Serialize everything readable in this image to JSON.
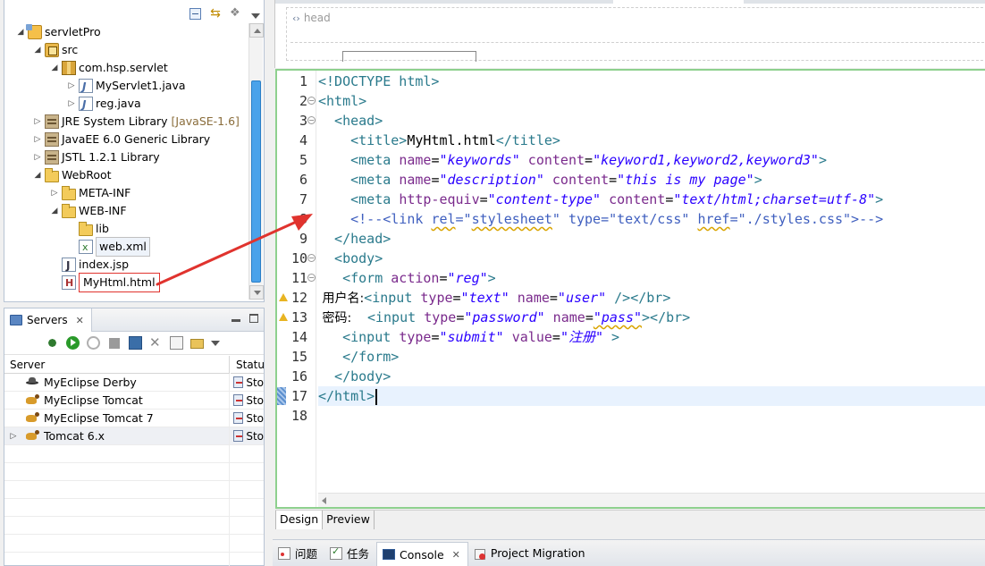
{
  "explorer": {
    "tree": [
      {
        "label": "servletPro",
        "twisty": "◢",
        "icon": "project-icon",
        "indent": 0
      },
      {
        "label": "src",
        "twisty": "◢",
        "icon": "source-folder-icon",
        "indent": 1
      },
      {
        "label": "com.hsp.servlet",
        "twisty": "◢",
        "icon": "package-icon",
        "indent": 2
      },
      {
        "label": "MyServlet1.java",
        "twisty": "▷",
        "icon": "java-file-icon",
        "indent": 3
      },
      {
        "label": "reg.java",
        "twisty": "▷",
        "icon": "java-file-icon",
        "indent": 3
      },
      {
        "label": "JRE System Library",
        "version": "[JavaSE-1.6]",
        "twisty": "▷",
        "icon": "library-icon",
        "indent": 1
      },
      {
        "label": "JavaEE 6.0 Generic Library",
        "twisty": "▷",
        "icon": "library-icon",
        "indent": 1
      },
      {
        "label": "JSTL 1.2.1 Library",
        "twisty": "▷",
        "icon": "library-icon",
        "indent": 1
      },
      {
        "label": "WebRoot",
        "twisty": "◢",
        "icon": "folder-icon",
        "indent": 1
      },
      {
        "label": "META-INF",
        "twisty": "▷",
        "icon": "folder-icon",
        "indent": 2
      },
      {
        "label": "WEB-INF",
        "twisty": "◢",
        "icon": "folder-icon",
        "indent": 2
      },
      {
        "label": "lib",
        "twisty": "",
        "icon": "folder-icon",
        "indent": 3
      },
      {
        "label": "web.xml",
        "twisty": "",
        "icon": "xml-file-icon",
        "indent": 3,
        "selected": true
      },
      {
        "label": "index.jsp",
        "twisty": "",
        "icon": "jsp-file-icon",
        "indent": 2
      },
      {
        "label": "MyHtml.html",
        "twisty": "",
        "icon": "html-file-icon",
        "indent": 2,
        "highlighted": true
      }
    ]
  },
  "servers": {
    "tab_label": "Servers",
    "columns": {
      "server": "Server",
      "status": "Status"
    },
    "rows": [
      {
        "name": "MyEclipse Derby",
        "status": "Sto",
        "icon": "derby-icon",
        "twisty": ""
      },
      {
        "name": "MyEclipse Tomcat",
        "status": "Sto",
        "icon": "tomcat-icon",
        "twisty": ""
      },
      {
        "name": "MyEclipse Tomcat 7",
        "status": "Sto",
        "icon": "tomcat-icon",
        "twisty": ""
      },
      {
        "name": "Tomcat  6.x",
        "status": "Sto",
        "icon": "tomcat-icon",
        "twisty": "▷",
        "selected": true
      }
    ]
  },
  "design_view": {
    "head_label": "head"
  },
  "editor": {
    "current_line": 17,
    "lines": [
      {
        "n": "1",
        "tokens": [
          {
            "t": "<!DOCTYPE html>",
            "c": "tag"
          }
        ]
      },
      {
        "n": "2",
        "fold": true,
        "tokens": [
          {
            "t": "<html>",
            "c": "tag"
          }
        ]
      },
      {
        "n": "3",
        "fold": true,
        "tokens": [
          {
            "t": "  <head>",
            "c": "tag"
          }
        ]
      },
      {
        "n": "4",
        "tokens": [
          {
            "t": "    <title>",
            "c": "tag"
          },
          {
            "t": "MyHtml.html",
            "c": "text"
          },
          {
            "t": "</title>",
            "c": "tag"
          }
        ]
      },
      {
        "n": "5",
        "tokens": [
          {
            "t": "    <meta ",
            "c": "tag"
          },
          {
            "t": "name",
            "c": "attr"
          },
          {
            "t": "=",
            "c": "text"
          },
          {
            "t": "\"keywords\"",
            "c": "val"
          },
          {
            "t": " content",
            "c": "attr"
          },
          {
            "t": "=",
            "c": "text"
          },
          {
            "t": "\"keyword1,keyword2,keyword3\"",
            "c": "val"
          },
          {
            "t": ">",
            "c": "tag"
          }
        ]
      },
      {
        "n": "6",
        "tokens": [
          {
            "t": "    <meta ",
            "c": "tag"
          },
          {
            "t": "name",
            "c": "attr"
          },
          {
            "t": "=",
            "c": "text"
          },
          {
            "t": "\"description\"",
            "c": "val"
          },
          {
            "t": " content",
            "c": "attr"
          },
          {
            "t": "=",
            "c": "text"
          },
          {
            "t": "\"this is my page\"",
            "c": "val"
          },
          {
            "t": ">",
            "c": "tag"
          }
        ]
      },
      {
        "n": "7",
        "tokens": [
          {
            "t": "    <meta ",
            "c": "tag"
          },
          {
            "t": "http-equiv",
            "c": "attr"
          },
          {
            "t": "=",
            "c": "text"
          },
          {
            "t": "\"content-type\"",
            "c": "val"
          },
          {
            "t": " content",
            "c": "attr"
          },
          {
            "t": "=",
            "c": "text"
          },
          {
            "t": "\"text/html;charset=utf-8\"",
            "c": "val"
          },
          {
            "t": ">",
            "c": "tag"
          }
        ]
      },
      {
        "n": "8",
        "tokens": [
          {
            "t": "    <!--<link ",
            "c": "comment"
          },
          {
            "t": "rel",
            "c": "comment",
            "w": true
          },
          {
            "t": "=\"",
            "c": "comment"
          },
          {
            "t": "stylesheet",
            "c": "comment",
            "w": true
          },
          {
            "t": "\" type=\"text/css\" ",
            "c": "comment"
          },
          {
            "t": "href",
            "c": "comment",
            "w": true
          },
          {
            "t": "=\"./styles.css\">-->",
            "c": "comment"
          }
        ]
      },
      {
        "n": "9",
        "tokens": [
          {
            "t": "  </head>",
            "c": "tag"
          }
        ]
      },
      {
        "n": "10",
        "fold": true,
        "tokens": [
          {
            "t": "  <body>",
            "c": "tag"
          }
        ]
      },
      {
        "n": "11",
        "fold": true,
        "tokens": [
          {
            "t": "   <form ",
            "c": "tag"
          },
          {
            "t": "action",
            "c": "attr"
          },
          {
            "t": "=",
            "c": "text"
          },
          {
            "t": "\"reg\"",
            "c": "val"
          },
          {
            "t": ">",
            "c": "tag"
          }
        ]
      },
      {
        "n": "12",
        "warn": true,
        "tokens": [
          {
            "t": " 用户名:",
            "c": "cjk"
          },
          {
            "t": "<input ",
            "c": "tag"
          },
          {
            "t": "type",
            "c": "attr"
          },
          {
            "t": "=",
            "c": "text"
          },
          {
            "t": "\"text\"",
            "c": "val"
          },
          {
            "t": " name",
            "c": "attr"
          },
          {
            "t": "=",
            "c": "text"
          },
          {
            "t": "\"user\"",
            "c": "val"
          },
          {
            "t": " /></br>",
            "c": "tag"
          }
        ]
      },
      {
        "n": "13",
        "warn": true,
        "tokens": [
          {
            "t": " 密码:    ",
            "c": "cjk"
          },
          {
            "t": "<input ",
            "c": "tag"
          },
          {
            "t": "type",
            "c": "attr"
          },
          {
            "t": "=",
            "c": "text"
          },
          {
            "t": "\"password\"",
            "c": "val"
          },
          {
            "t": " name",
            "c": "attr"
          },
          {
            "t": "=",
            "c": "text"
          },
          {
            "t": "\"pass\"",
            "c": "val",
            "w": true
          },
          {
            "t": "></br>",
            "c": "tag"
          }
        ]
      },
      {
        "n": "14",
        "tokens": [
          {
            "t": "   <input ",
            "c": "tag"
          },
          {
            "t": "type",
            "c": "attr"
          },
          {
            "t": "=",
            "c": "text"
          },
          {
            "t": "\"submit\"",
            "c": "val"
          },
          {
            "t": " value",
            "c": "attr"
          },
          {
            "t": "=",
            "c": "text"
          },
          {
            "t": "\"注册\"",
            "c": "val"
          },
          {
            "t": " >",
            "c": "tag"
          }
        ]
      },
      {
        "n": "15",
        "tokens": [
          {
            "t": "   </form>",
            "c": "tag"
          }
        ]
      },
      {
        "n": "16",
        "tokens": [
          {
            "t": "  </body>",
            "c": "tag"
          }
        ]
      },
      {
        "n": "17",
        "tokens": [
          {
            "t": "</html>",
            "c": "tag"
          }
        ]
      },
      {
        "n": "18",
        "tokens": []
      }
    ]
  },
  "mode_tabs": [
    "Design",
    "Preview"
  ],
  "bottom_tabs": [
    {
      "label": "问题",
      "icon": "problems-icon"
    },
    {
      "label": "任务",
      "icon": "tasks-icon"
    },
    {
      "label": "Console",
      "icon": "console-icon",
      "active": true
    },
    {
      "label": "Project Migration",
      "icon": "migration-icon"
    }
  ],
  "colors": {
    "annotation": "#e0332e",
    "editor_border": "#8ed08e",
    "scrollbar_thumb": "#4aa2ea"
  }
}
